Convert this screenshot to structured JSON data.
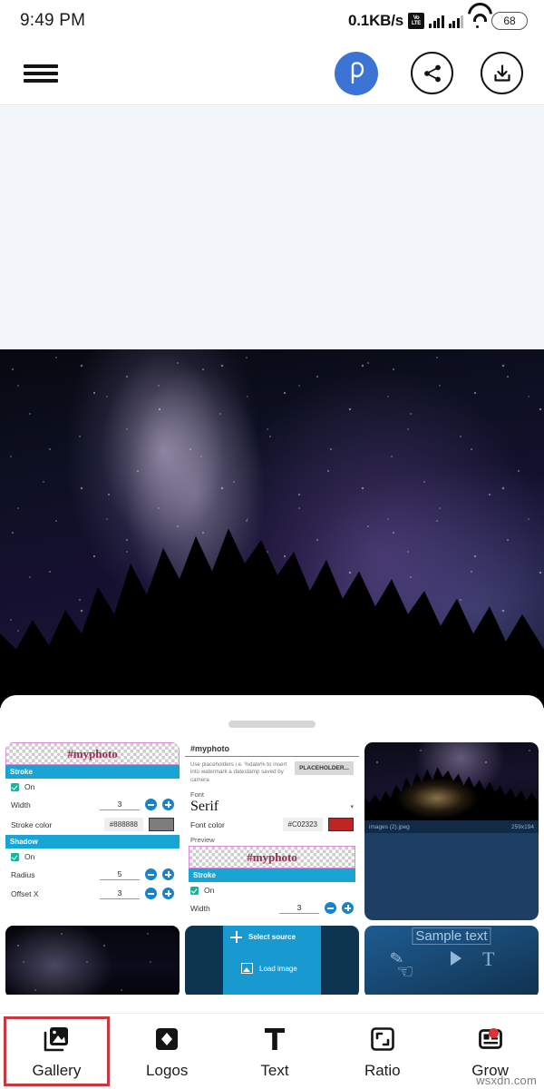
{
  "status_bar": {
    "clock": "9:49 PM",
    "network_speed": "0.1KB/s",
    "volte_top": "Vo",
    "volte_bottom": "LTE",
    "battery": "68"
  },
  "toolbar": {
    "menu_icon": "hamburger-menu-icon",
    "logo_icon": "photopills-p-logo-icon",
    "share_icon": "share-icon",
    "download_icon": "download-icon"
  },
  "editor": {
    "canvas_background": "#f2f5fa",
    "photo_alt": "milky-way-night-sky-over-pine-trees"
  },
  "sheet": {
    "drag_handle": "bottom-sheet-drag-handle",
    "thumbnails": [
      {
        "type": "settings-screenshot",
        "preview_text": "#myphoto",
        "sections": [
          {
            "title": "Stroke",
            "rows": [
              {
                "label": "On",
                "kind": "checkbox",
                "checked": true
              },
              {
                "label": "Width",
                "kind": "stepper",
                "value": "3"
              },
              {
                "label": "Stroke color",
                "kind": "color",
                "value": "#888888",
                "swatch": "#7d7d7d"
              }
            ]
          },
          {
            "title": "Shadow",
            "rows": [
              {
                "label": "On",
                "kind": "checkbox",
                "checked": true
              },
              {
                "label": "Radius",
                "kind": "stepper",
                "value": "5"
              },
              {
                "label": "Offset X",
                "kind": "stepper",
                "value": "3"
              }
            ]
          }
        ]
      },
      {
        "type": "font-settings-screenshot",
        "title_value": "#myphoto",
        "hint": "Use placeholders i.e. %date% to insert into watermark a datestamp saved by camera",
        "placeholder_button": "PLACEHOLDER...",
        "font_label": "Font",
        "font_value": "Serif",
        "font_color_label": "Font color",
        "font_color_value": "#C02323",
        "font_color_swatch": "#c02323",
        "preview_label": "Preview",
        "preview_text": "#myphoto",
        "stroke_title": "Stroke",
        "stroke_on_label": "On",
        "width_label": "Width",
        "width_value": "3"
      },
      {
        "type": "photo-with-meta",
        "filename": "images (2).jpeg",
        "dimensions": "259x194"
      },
      {
        "type": "night-sky-photo",
        "alt": "starry-night-sky"
      },
      {
        "type": "select-source-panel",
        "title": "Select source",
        "item": "Load image"
      },
      {
        "type": "sample-text-panel",
        "sample_text": "Sample text"
      }
    ]
  },
  "bottom_nav": {
    "items": [
      {
        "label": "Gallery",
        "icon": "gallery-images-icon",
        "selected": true,
        "badge": false
      },
      {
        "label": "Logos",
        "icon": "diamond-logo-icon",
        "selected": false,
        "badge": false
      },
      {
        "label": "Text",
        "icon": "text-t-icon",
        "selected": false,
        "badge": false
      },
      {
        "label": "Ratio",
        "icon": "aspect-ratio-icon",
        "selected": false,
        "badge": false
      },
      {
        "label": "Grow",
        "icon": "article-grow-icon",
        "selected": false,
        "badge": true
      }
    ],
    "selected_border_color": "#c8393f",
    "badge_color": "#e03232"
  },
  "watermark": "wsxdn.com"
}
